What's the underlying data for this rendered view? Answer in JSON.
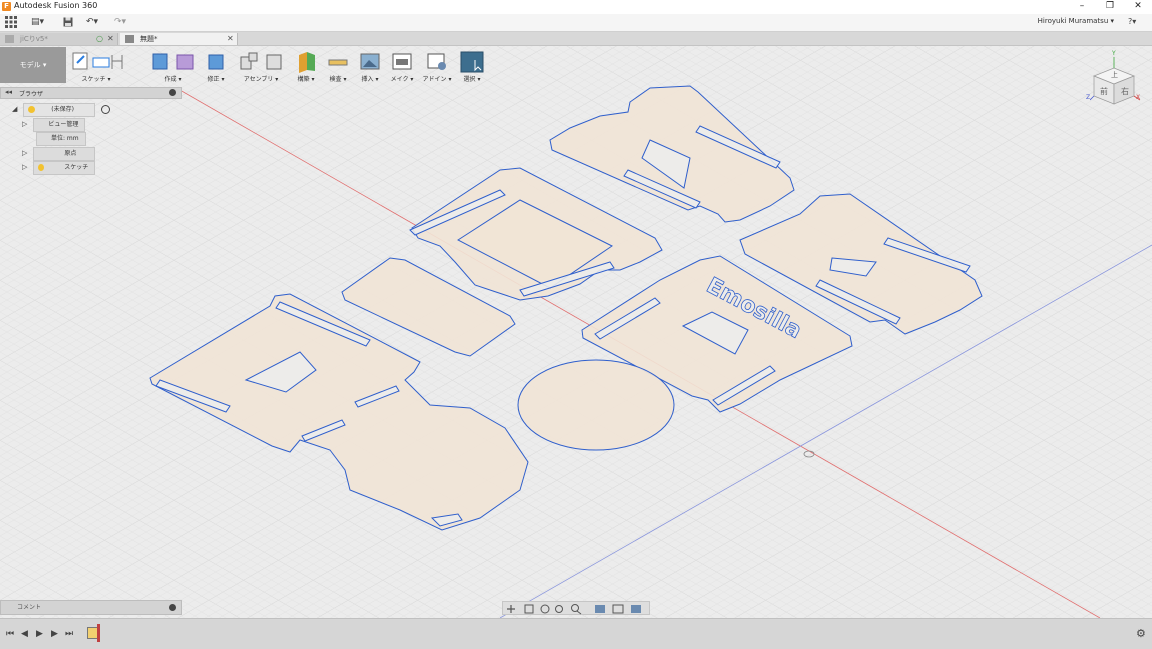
{
  "titlebar": {
    "app_title": "Autodesk Fusion 360",
    "logo": "F",
    "minimize": "–",
    "restore": "❐",
    "close": "✕"
  },
  "appbar": {
    "grid_icon": "grid-icon",
    "file_icon": "▤▾",
    "save_icon": "▪",
    "undo_icon": "↶▾",
    "redo_icon": "↷▾",
    "user": "Hiroyuki Muramatsu ▾",
    "help": "?▾"
  },
  "tabs": [
    {
      "label": "jiCりv5*",
      "status": "○",
      "close": "✕"
    },
    {
      "label": "無題*",
      "close": "✕"
    }
  ],
  "toolbar": {
    "workspace": "モデル ▾",
    "groups": [
      {
        "label": "スケッチ ▾"
      },
      {
        "label": "作成 ▾"
      },
      {
        "label": "修正 ▾"
      },
      {
        "label": "アセンブリ ▾"
      },
      {
        "label": "構築 ▾"
      },
      {
        "label": "検査 ▾"
      },
      {
        "label": "挿入 ▾"
      },
      {
        "label": "メイク ▾"
      },
      {
        "label": "アドイン ▾"
      },
      {
        "label": "選択 ▾"
      }
    ]
  },
  "browser": {
    "header": "ブラウザ",
    "root": "(未保存)",
    "items": [
      {
        "label": "ビュー管理"
      },
      {
        "label": "単位: mm"
      },
      {
        "label": "原点"
      },
      {
        "label": "スケッチ"
      }
    ]
  },
  "viewcube": {
    "top": "上",
    "front": "前",
    "right": "右",
    "x": "X",
    "y": "Y",
    "z": "Z"
  },
  "sketch_text": "Emosilla",
  "comment": {
    "label": "コメント"
  },
  "timeline": {
    "first": "⏮",
    "prev": "◀",
    "play": "▶",
    "next": "▶",
    "last": "⏭",
    "settings": "⚙"
  },
  "colors": {
    "sketch_fill": "#f1e4d6",
    "sketch_stroke": "#2f5fcc",
    "grid": "#d8d8d8",
    "axis_red": "#e06060",
    "axis_blue": "#7a8ad8",
    "select_accent": "#3d6e8e"
  }
}
